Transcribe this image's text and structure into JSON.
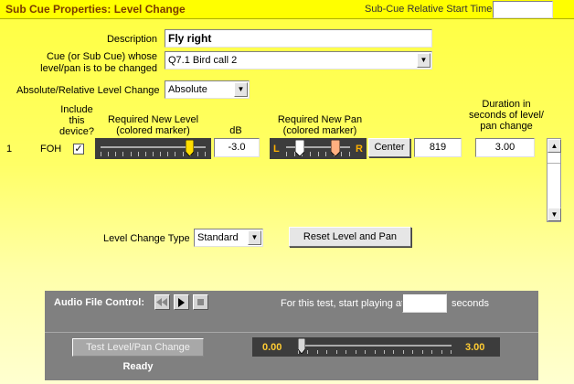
{
  "window": {
    "title": "Sub Cue Properties: Level Change",
    "start_time_label": "Sub-Cue Relative Start Time",
    "start_time_value": ""
  },
  "form": {
    "description_label": "Description",
    "description_value": "Fly right",
    "cue_label_line1": "Cue (or Sub Cue) whose",
    "cue_label_line2": "level/pan is to be changed",
    "cue_value": "Q7.1  Bird call 2",
    "abs_rel_label": "Absolute/Relative Level Change",
    "abs_rel_value": "Absolute"
  },
  "headers": {
    "include_line1": "Include",
    "include_line2": "this",
    "include_line3": "device?",
    "level_line1": "Required New Level",
    "level_line2": "(colored marker)",
    "db": "dB",
    "pan_line1": "Required New Pan",
    "pan_line2": "(colored marker)",
    "duration_line1": "Duration in",
    "duration_line2": "seconds of level/",
    "duration_line3": "pan change"
  },
  "device_row": {
    "index": "1",
    "device": "FOH",
    "include_checked": true,
    "check_glyph": "✓",
    "level_db": "-3.0",
    "level_fraction": 0.85,
    "pan_left_label": "L",
    "pan_right_label": "R",
    "center_label": "Center",
    "pan_value": "819",
    "duration": "3.00"
  },
  "level_change": {
    "type_label": "Level Change Type",
    "type_value": "Standard",
    "reset_label": "Reset Level and Pan"
  },
  "audio": {
    "control_label": "Audio File Control:",
    "start_prefix": "For this test, start playing at",
    "start_value": "",
    "start_suffix": "seconds",
    "test_button": "Test Level/Pan Change",
    "status": "Ready",
    "slider_min": "0.00",
    "slider_max": "3.00",
    "slider_fraction": 0.0
  },
  "colors": {
    "accent_title": "#7a3b00",
    "marker_yellow": "#ffdd00",
    "marker_salmon": "#ffb080",
    "slider_value": "#ffcc33"
  },
  "icons": {
    "rewind": "rewind-icon",
    "play": "play-icon",
    "stop": "stop-icon",
    "checkmark": "checkmark-icon",
    "dropdown": "chevron-down-icon",
    "scroll_up": "scroll-up-icon",
    "scroll_down": "scroll-down-icon"
  }
}
